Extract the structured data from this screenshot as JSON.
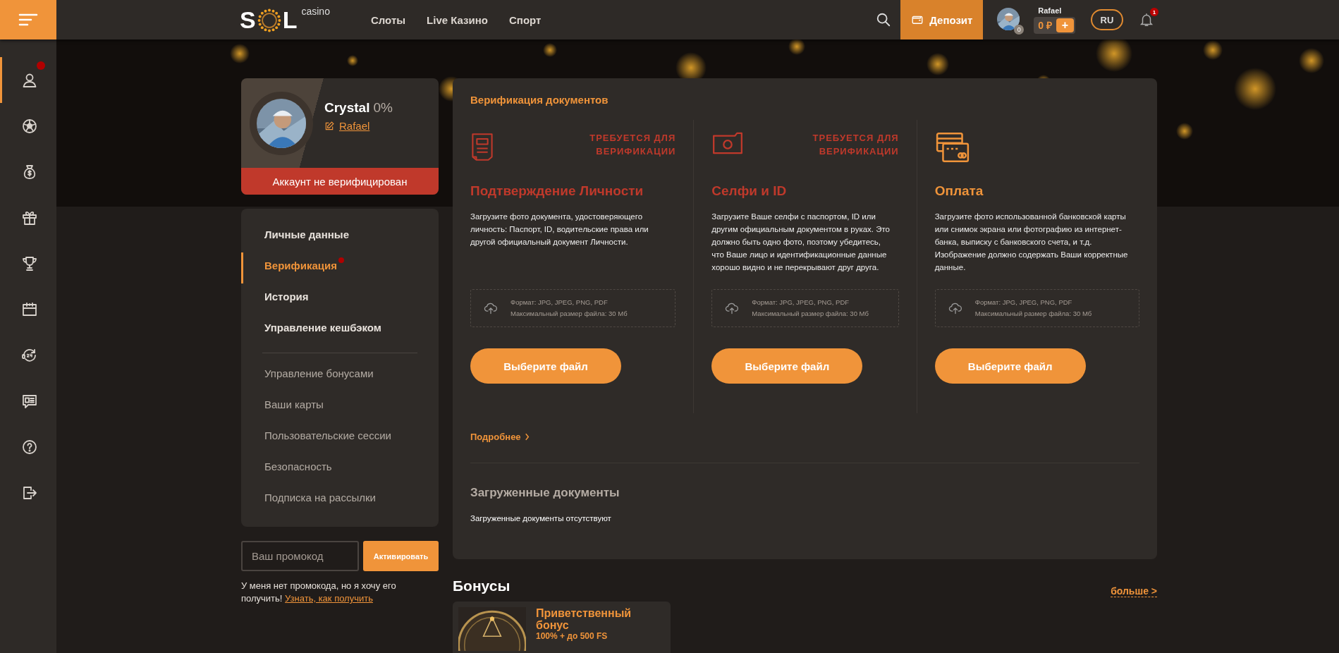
{
  "topbar": {
    "logo": {
      "text": "S",
      "text_end": "L",
      "sub": "casino"
    },
    "nav": [
      {
        "label": "Слоты"
      },
      {
        "label": "Live Казино"
      },
      {
        "label": "Спорт"
      }
    ],
    "deposit": "Депозит",
    "user": {
      "name": "Rafael",
      "level_badge": "0",
      "balance": "0 ₽",
      "add": "+"
    },
    "language": "RU",
    "notifications": "1"
  },
  "sidebar": {
    "items": [
      {
        "kind": "user",
        "selected": true,
        "notification": true
      },
      {
        "kind": "ball",
        "selected": false,
        "notification": false
      },
      {
        "kind": "moneybag",
        "selected": false,
        "notification": false
      },
      {
        "kind": "gift",
        "selected": false,
        "notification": false
      },
      {
        "kind": "trophy",
        "selected": false,
        "notification": false
      },
      {
        "kind": "calendar",
        "selected": false,
        "notification": false
      },
      {
        "kind": "support",
        "selected": false,
        "notification": false
      },
      {
        "kind": "news",
        "selected": false,
        "notification": false
      },
      {
        "kind": "help",
        "selected": false,
        "notification": false
      },
      {
        "kind": "logout",
        "selected": false,
        "notification": false
      }
    ]
  },
  "profile": {
    "name": "Crystal",
    "progress": "0%",
    "username": "Rafael",
    "status": "Аккаунт не верифицирован",
    "verified": false
  },
  "account_menu": [
    {
      "label": "Личные данные",
      "kind": "primary",
      "selected": false,
      "notification": false
    },
    {
      "label": "Верификация",
      "kind": "primary",
      "selected": true,
      "notification": true
    },
    {
      "label": "История",
      "kind": "primary",
      "selected": false,
      "notification": false
    },
    {
      "label": "Управление кешбэком",
      "kind": "primary",
      "selected": false,
      "notification": false
    },
    {
      "label": "Управление бонусами",
      "kind": "secondary",
      "selected": false,
      "notification": false
    },
    {
      "label": "Ваши карты",
      "kind": "secondary",
      "selected": false,
      "notification": false
    },
    {
      "label": "Пользовательские сессии",
      "kind": "secondary",
      "selected": false,
      "notification": false
    },
    {
      "label": "Безопасность",
      "kind": "secondary",
      "selected": false,
      "notification": false
    },
    {
      "label": "Подписка на рассылки",
      "kind": "secondary",
      "selected": false,
      "notification": false
    }
  ],
  "promo": {
    "placeholder": "Ваш промокод",
    "button": "Активировать",
    "note": "У меня нет промокода, но я хочу его получить!",
    "link": "Узнать, как получить"
  },
  "verification": {
    "title": "Верификация документов",
    "documents": [
      {
        "kind": "document",
        "required": true,
        "required_label": "ТРЕБУЕТСЯ ДЛЯ ВЕРИФИКАЦИИ",
        "title": "Подтверждение Личности",
        "description": "Загрузите фото документа, удостоверяющего личность: Паспорт, ID, водительские права или другой официальный документ Личности.",
        "format": "Формат: JPG, JPEG, PNG, PDF",
        "max_size": "Максимальный размер файла: 30 Мб",
        "button": "Выберите файл"
      },
      {
        "kind": "camera",
        "required": true,
        "required_label": "ТРЕБУЕТСЯ ДЛЯ ВЕРИФИКАЦИИ",
        "title": "Селфи и ID",
        "description": "Загрузите Ваше селфи с паспортом, ID или другим официальным документом в руках. Это должно быть одно фото, поэтому убедитесь, что Ваше лицо и идентификационные данные хорошо видно и не перекрывают друг друга.",
        "format": "Формат: JPG, JPEG, PNG, PDF",
        "max_size": "Максимальный размер файла: 30 Мб",
        "button": "Выберите файл"
      },
      {
        "kind": "cards",
        "required": false,
        "title": "Оплата",
        "description": "Загрузите фото использованной банковской карты или снимок экрана или фотографию из интернет-банка, выписку с банковского счета, и т.д. Изображение должно содержать Ваши корректные данные.",
        "format": "Формат: JPG, JPEG, PNG, PDF",
        "max_size": "Максимальный размер файла: 30 Мб",
        "button": "Выберите файл"
      }
    ],
    "more": "Подробнее",
    "uploaded": {
      "title": "Загруженные документы",
      "empty": "Загруженные документы отсутствуют"
    }
  },
  "bonuses": {
    "title": "Бонусы",
    "more": "больше >",
    "items": [
      {
        "title": "Приветственный бонус",
        "subtitle": "100% + до 500 FS"
      }
    ]
  }
}
